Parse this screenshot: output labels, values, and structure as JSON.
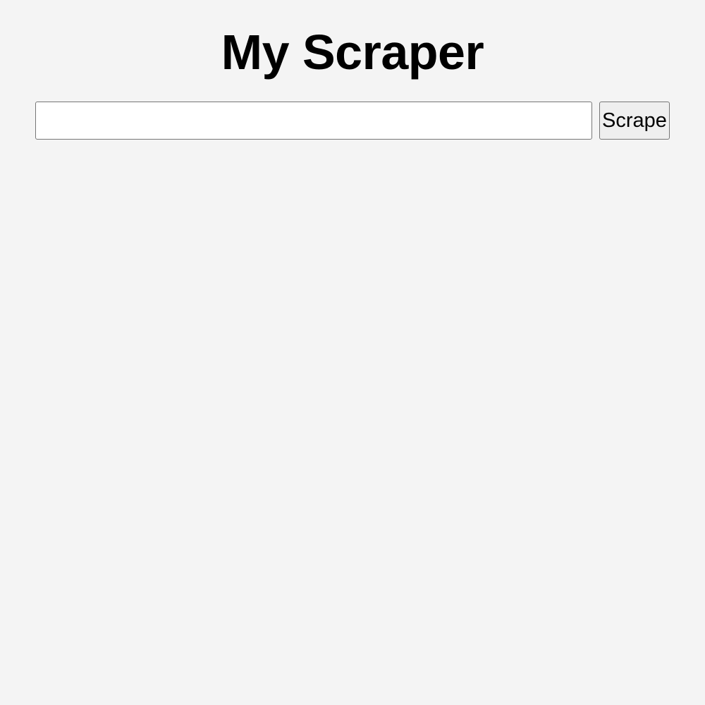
{
  "header": {
    "title": "My Scraper"
  },
  "form": {
    "url_input": {
      "value": "",
      "placeholder": ""
    },
    "scrape_button_label": "Scrape"
  },
  "colors": {
    "background": "#f4f4f4",
    "input_background": "#ffffff",
    "button_background": "#efefef",
    "border": "#767676",
    "text": "#000000"
  }
}
